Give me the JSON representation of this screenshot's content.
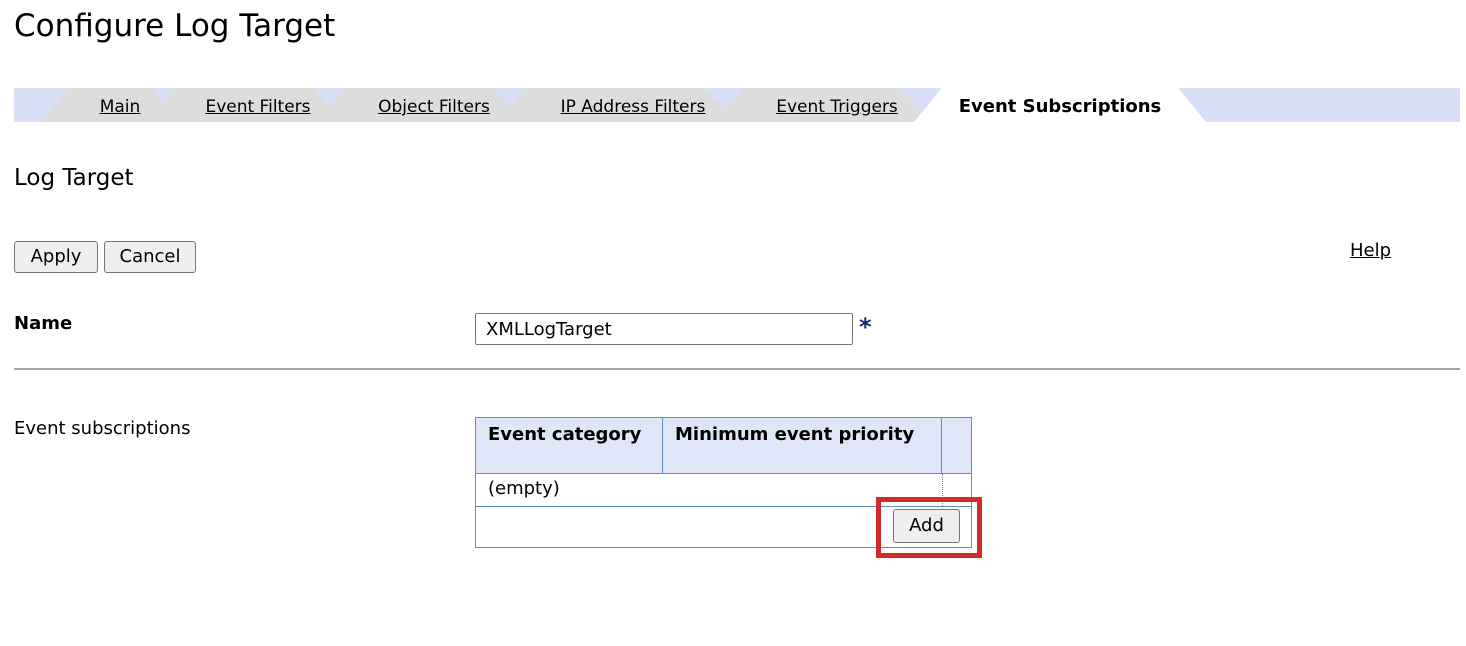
{
  "page": {
    "title": "Configure Log Target"
  },
  "tabs": [
    {
      "label": "Main",
      "active": false
    },
    {
      "label": "Event Filters",
      "active": false
    },
    {
      "label": "Object Filters",
      "active": false
    },
    {
      "label": "IP Address Filters",
      "active": false
    },
    {
      "label": "Event Triggers",
      "active": false
    },
    {
      "label": "Event Subscriptions",
      "active": true
    }
  ],
  "section": {
    "title": "Log Target"
  },
  "actions": {
    "apply_label": "Apply",
    "cancel_label": "Cancel",
    "help_label": "Help"
  },
  "name_field": {
    "label": "Name",
    "value": "XMLLogTarget",
    "required_mark": "*"
  },
  "subscriptions": {
    "label": "Event subscriptions",
    "columns": [
      "Event category",
      "Minimum event priority",
      ""
    ],
    "rows": [
      {
        "event_category": "(empty)",
        "minimum_event_priority": ""
      }
    ],
    "add_label": "Add"
  },
  "colors": {
    "tabbar_bg": "#d9dff7",
    "table_border": "#5e8ec4",
    "table_header_bg": "#dfe6f8",
    "highlight": "#d32a2a",
    "required": "#1a2b6d"
  }
}
